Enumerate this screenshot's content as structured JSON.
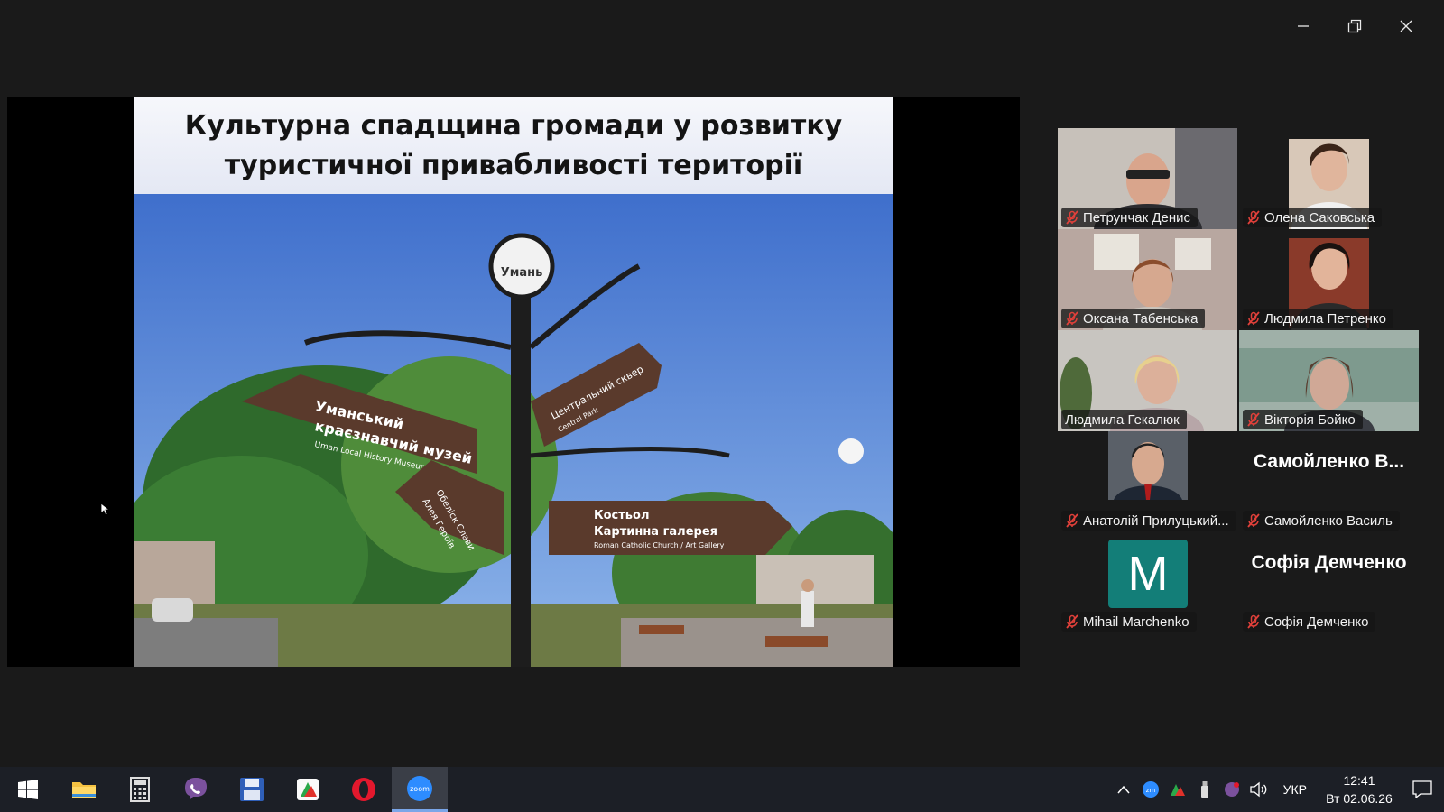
{
  "window_controls": {
    "minimize": "minimize",
    "restore": "restore",
    "close": "close"
  },
  "slide": {
    "title_line1": "Культурна спадщина громади у розвитку",
    "title_line2": "туристичної привабливості території",
    "logo_text": "Умань",
    "sign1_line1": "Уманський",
    "sign1_line2": "краєзнавчий музей",
    "sign1_sub": "Uman Local History Museum",
    "sign2": "Центральний сквер",
    "sign2_sub": "Central Park",
    "sign3_line1": "Обеліск Слави",
    "sign3_line2": "Алея Героїв",
    "sign4_line1": "Костьол",
    "sign4_line2": "Картинна галерея",
    "sign4_sub": "Roman Catholic Church / Art Gallery"
  },
  "participants": [
    {
      "name": "Петрунчак Денис",
      "muted": true,
      "video": true
    },
    {
      "name": "Олена Саковська",
      "muted": true,
      "video": true
    },
    {
      "name": "Оксана Табенська",
      "muted": true,
      "video": true
    },
    {
      "name": "Людмила Петренко",
      "muted": true,
      "video": true
    },
    {
      "name": "Людмила Гекалюк",
      "muted": false,
      "video": true,
      "active_speaker": true
    },
    {
      "name": "Вікторія Бойко",
      "muted": true,
      "video": true
    },
    {
      "name": "Анатолій Прилуцький...",
      "muted": true,
      "video": true
    },
    {
      "name": "Самойленко Василь",
      "muted": true,
      "video": false,
      "display_name": "Самойленко  В..."
    },
    {
      "name": "Mihail Marchenko",
      "muted": true,
      "video": false,
      "avatar_letter": "M"
    },
    {
      "name": "Софія Демченко",
      "muted": true,
      "video": false,
      "display_name": "Софія Демченко"
    }
  ],
  "taskbar": {
    "apps": [
      "start",
      "file-explorer",
      "calculator",
      "viber",
      "save-disk",
      "media-app",
      "opera",
      "zoom"
    ],
    "zoom_label": "zoom",
    "language": "УКР",
    "time": "12:41",
    "date": "Вт 02.06.26"
  },
  "colors": {
    "active_speaker": "#23d160",
    "mute": "#e0403a",
    "avatar_bg": "#137e78"
  }
}
